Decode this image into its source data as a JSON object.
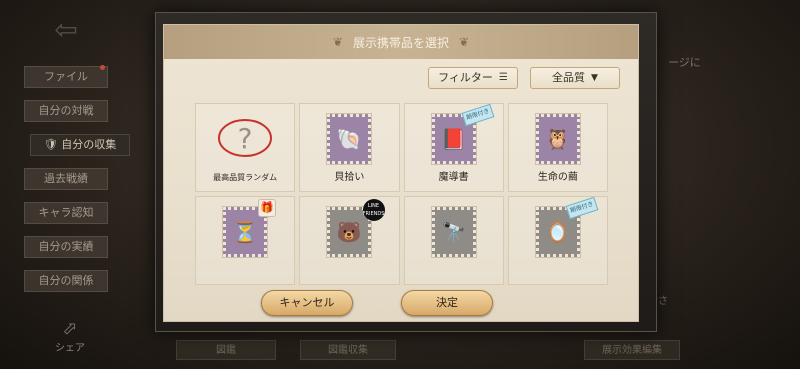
{
  "background": {
    "side_menu": [
      "ファイル",
      "自分の対戦",
      "自分の収集",
      "過去戦績",
      "キャラ認知",
      "自分の実績",
      "自分の関係"
    ],
    "active_index": 2,
    "share_label": "シェア",
    "right_fragment": "ージに",
    "right_fragment2": "示さ",
    "bottom_labels": [
      "図鑑",
      "図鑑収集",
      "展示効果編集"
    ]
  },
  "dialog": {
    "title": "展示携帯品を選択",
    "filter_label": "フィルター",
    "quality_label": "全品質",
    "items": [
      {
        "label": "最高品質ランダム",
        "kind": "random",
        "badge": ""
      },
      {
        "label": "貝拾い",
        "kind": "purple",
        "icon": "🐚",
        "badge": ""
      },
      {
        "label": "魔導書",
        "kind": "purple",
        "icon": "📕",
        "badge": "new"
      },
      {
        "label": "生命の繭",
        "kind": "purple",
        "icon": "🦉",
        "badge": ""
      },
      {
        "label": "",
        "kind": "purple",
        "icon": "⏳",
        "badge": "gift"
      },
      {
        "label": "",
        "kind": "gray",
        "icon": "🐻",
        "badge": "line"
      },
      {
        "label": "",
        "kind": "gray",
        "icon": "🔭",
        "badge": ""
      },
      {
        "label": "",
        "kind": "gray",
        "icon": "🪞",
        "badge": "new"
      }
    ],
    "badge_new_text": "期限付き",
    "badge_line_text": "LINE FRIENDS",
    "cancel_label": "キャンセル",
    "confirm_label": "決定"
  }
}
